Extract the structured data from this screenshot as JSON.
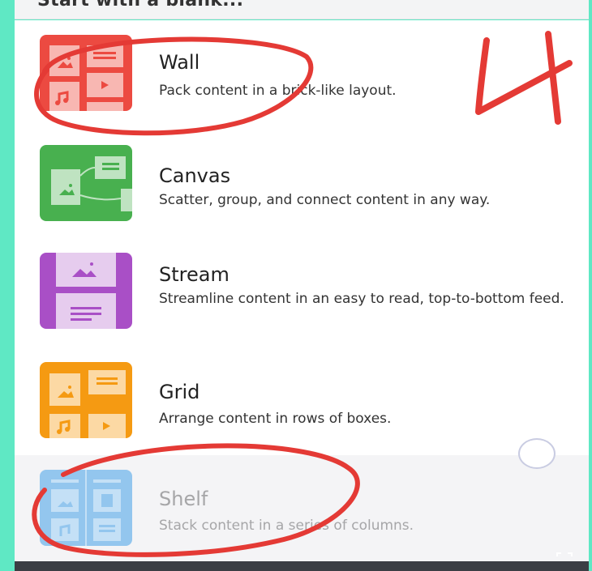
{
  "header": {
    "title": "Start with a blank..."
  },
  "layouts": [
    {
      "id": "wall",
      "title": "Wall",
      "description": "Pack content in a brick-like layout.",
      "icon": "wall-layout-icon",
      "color": "#ec4a41"
    },
    {
      "id": "canvas",
      "title": "Canvas",
      "description": "Scatter, group, and connect content in any way.",
      "icon": "canvas-layout-icon",
      "color": "#48b04f"
    },
    {
      "id": "stream",
      "title": "Stream",
      "description": "Streamline content in an easy to read, top-to-bottom feed.",
      "icon": "stream-layout-icon",
      "color": "#a94fc6"
    },
    {
      "id": "grid",
      "title": "Grid",
      "description": "Arrange content in rows of boxes.",
      "icon": "grid-layout-icon",
      "color": "#f59a12"
    },
    {
      "id": "shelf",
      "title": "Shelf",
      "description": "Stack content in a series of columns.",
      "icon": "shelf-layout-icon",
      "color": "#93c6ee",
      "disabled": true
    }
  ],
  "annotation": {
    "handwritten_number": "4",
    "ink_color": "#e43a35"
  },
  "colors": {
    "background_accent": "#5fe8c4"
  }
}
